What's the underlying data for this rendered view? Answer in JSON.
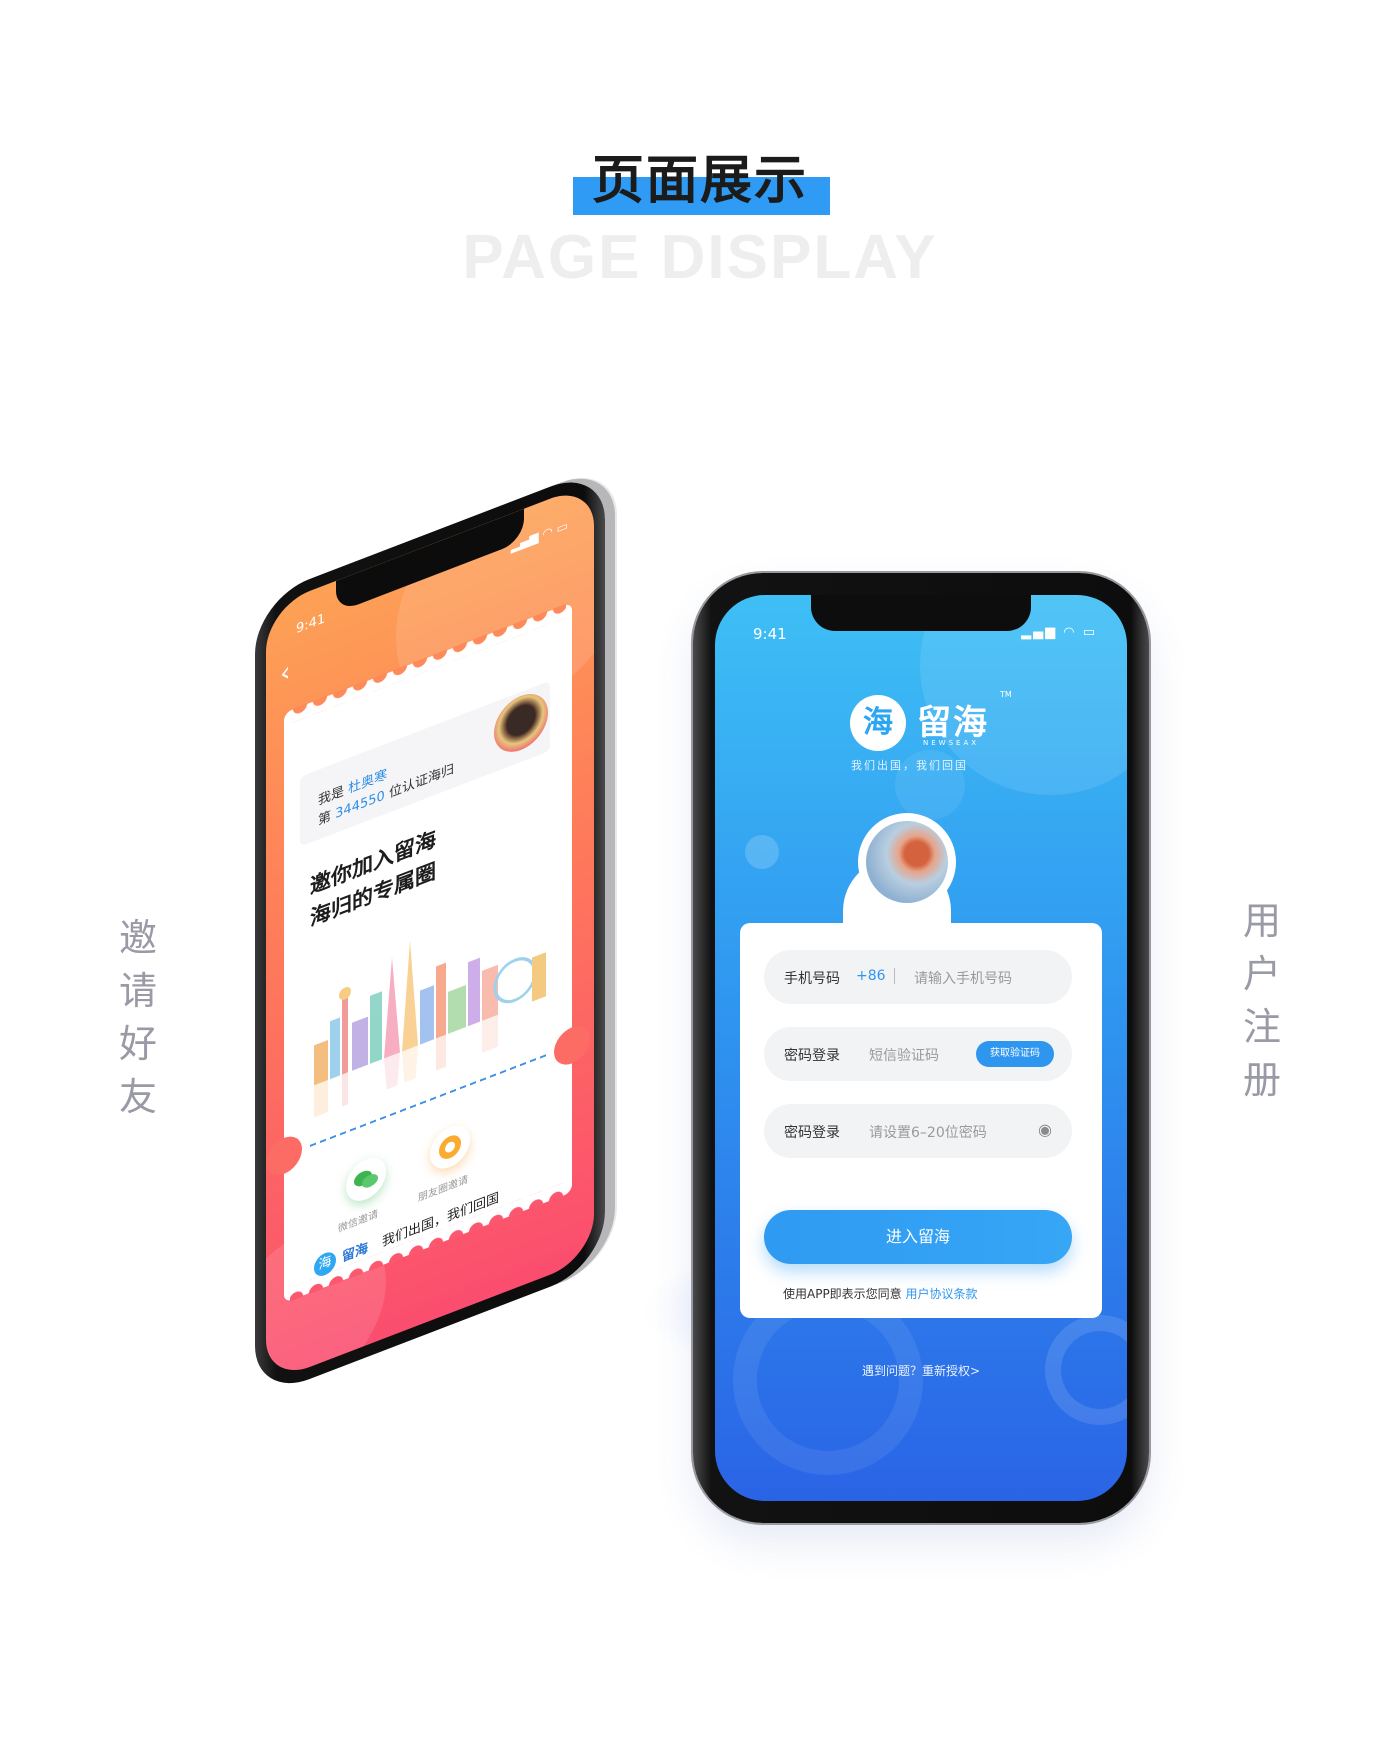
{
  "header": {
    "title": "页面展示",
    "subtitle": "PAGE DISPLAY",
    "accent_color": "#2f9bf4"
  },
  "side_labels": {
    "left": "邀请好友",
    "right": "用户注册"
  },
  "invite_screen": {
    "time": "9:41",
    "status_icons": "signal wifi battery",
    "back_icon": "chevron-left-icon",
    "user_prefix": "我是",
    "user_name": "杜奥寒",
    "rank_prefix": "第",
    "rank_number": "344550",
    "rank_suffix": "位认证海归",
    "invite_title_line1": "邀你加入留海",
    "invite_title_line2": "海归的专属圈",
    "share_wechat_label": "微信邀请",
    "share_moments_label": "朋友圈邀请",
    "logo_char": "海",
    "logo_name": "留海",
    "slogan": "我们出国，我们回国",
    "gradient_top": "#fda155",
    "gradient_bottom": "#fb4d6f"
  },
  "register_screen": {
    "time": "9:41",
    "logo_char": "海",
    "brand_name": "留海",
    "trademark": "TM",
    "brand_en": "NEWSEAX",
    "slogan": "我们出国，我们回国",
    "phone_label": "手机号码",
    "phone_code": "+86",
    "phone_placeholder": "请输入手机号码",
    "sms_label": "密码登录",
    "sms_placeholder": "短信验证码",
    "get_code_button": "获取验证码",
    "password_label": "密码登录",
    "password_placeholder": "请设置6–20位密码",
    "eye_icon": "eye-icon",
    "submit_button": "进入留海",
    "agreement_text": "使用APP即表示您同意",
    "agreement_link": "用户协议条款",
    "help_text": "遇到问题？重新授权>",
    "gradient_top": "#3ebff5",
    "gradient_bottom": "#2a64e6"
  }
}
